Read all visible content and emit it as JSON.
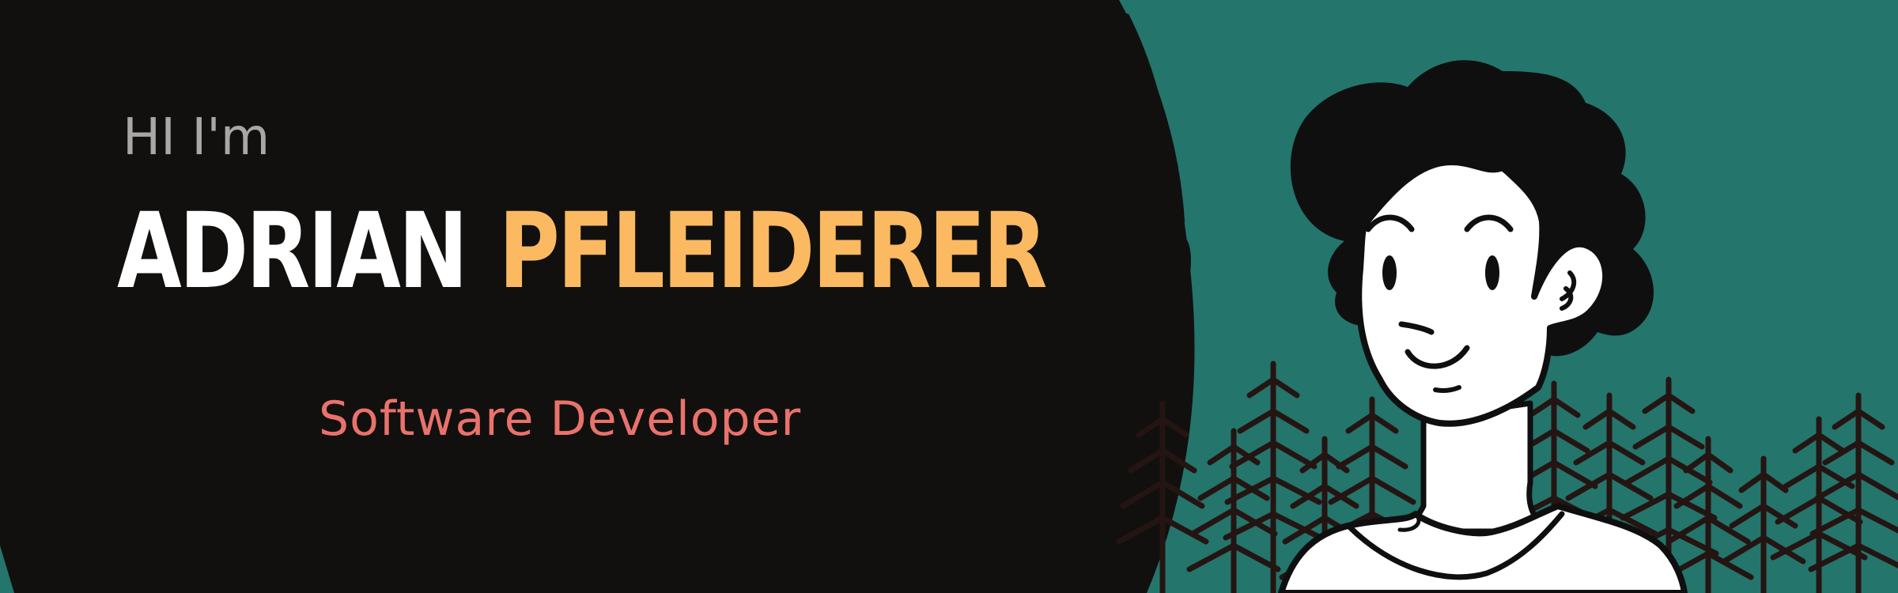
{
  "hero": {
    "greeting": "HI I'm",
    "first_name": "ADRIAN",
    "last_name": "PFLEIDERER",
    "subtitle": "Software Developer"
  },
  "colors": {
    "background": "#11100e",
    "teal": "#24756b",
    "greeting": "#a7a7a7",
    "first_name": "#ffffff",
    "last_name": "#fbb962",
    "subtitle": "#ea726c",
    "tree": "#241513"
  },
  "illustration": {
    "subject": "cartoon-person-portrait",
    "background": "pine-forest"
  }
}
